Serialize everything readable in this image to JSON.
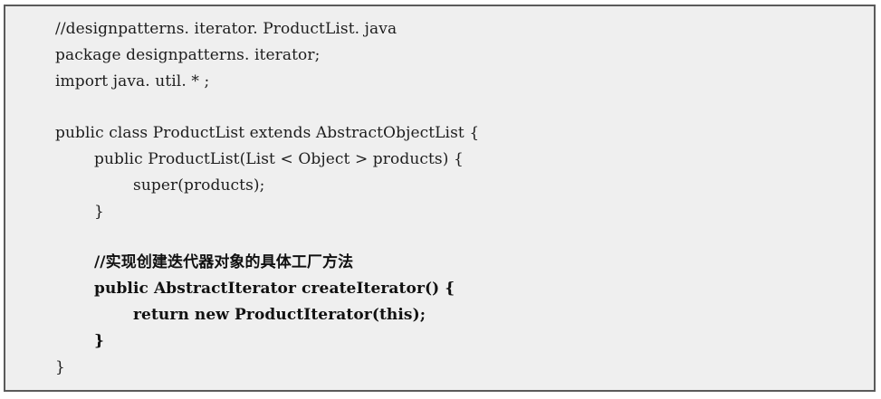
{
  "code": {
    "lines": [
      "//designpatterns. iterator. ProductList. java",
      "package designpatterns. iterator;",
      "import java. util. * ;",
      "",
      "public class ProductList extends AbstractObjectList {",
      "public ProductList(List < Object > products) {",
      "super(products);",
      "}",
      "",
      "//实现创建迭代器对象的具体工厂方法",
      "public AbstractIterator createIterator() {",
      "return new ProductIterator(this);",
      "}",
      "}"
    ]
  }
}
